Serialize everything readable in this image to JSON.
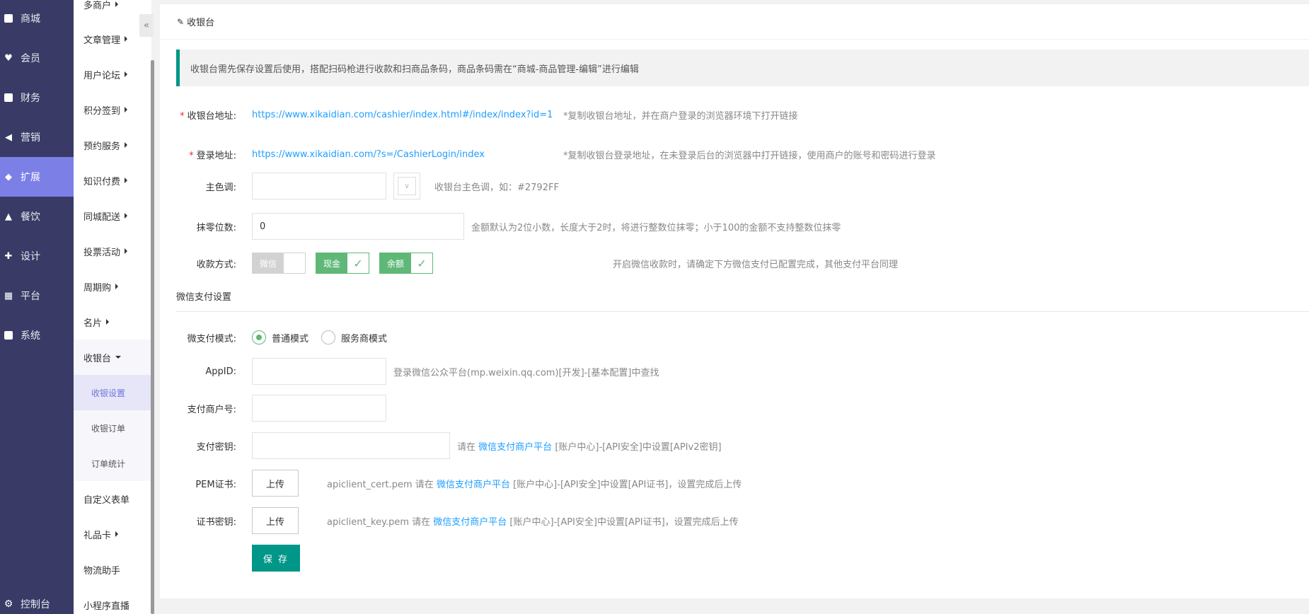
{
  "nav_primary": [
    {
      "label": "商城",
      "icon": "shop-icon"
    },
    {
      "label": "会员",
      "icon": "member-icon"
    },
    {
      "label": "财务",
      "icon": "finance-icon"
    },
    {
      "label": "营销",
      "icon": "megaphone-icon"
    },
    {
      "label": "扩展",
      "icon": "cube-icon"
    },
    {
      "label": "餐饮",
      "icon": "dining-icon"
    },
    {
      "label": "设计",
      "icon": "puzzle-icon"
    },
    {
      "label": "平台",
      "icon": "grid-icon"
    },
    {
      "label": "系统",
      "icon": "monitor-icon"
    }
  ],
  "nav_bottom": {
    "label": "控制台",
    "icon": "gear-icon"
  },
  "nav_secondary": [
    {
      "label": "多商户"
    },
    {
      "label": "文章管理"
    },
    {
      "label": "用户论坛"
    },
    {
      "label": "积分签到"
    },
    {
      "label": "预约服务"
    },
    {
      "label": "知识付费"
    },
    {
      "label": "同城配送"
    },
    {
      "label": "投票活动"
    },
    {
      "label": "周期购"
    },
    {
      "label": "名片"
    },
    {
      "label": "收银台"
    },
    {
      "label": "收银设置"
    },
    {
      "label": "收银订单"
    },
    {
      "label": "订单统计"
    },
    {
      "label": "自定义表单"
    },
    {
      "label": "礼品卡"
    },
    {
      "label": "物流助手"
    },
    {
      "label": "小程序直播"
    }
  ],
  "collapse_glyph": "«",
  "header": {
    "title": "收银台"
  },
  "notice": "收银台需先保存设置后使用，搭配扫码枪进行收款和扫商品条码，商品条码需在“商城-商品管理-编辑”进行编辑",
  "cashier_url": {
    "label": "收银台地址:",
    "value": "https://www.xikaidian.com/cashier/index.html#/index/index?id=1",
    "hint": "*复制收银台地址，并在商户登录的浏览器环境下打开链接"
  },
  "login_url": {
    "label": "登录地址:",
    "value": "https://www.xikaidian.com/?s=/CashierLogin/index",
    "hint": "*复制收银台登录地址，在未登录后台的浏览器中打开链接，使用商户的账号和密码进行登录"
  },
  "main_color": {
    "label": "主色调:",
    "value": "",
    "hint": "收银台主色调，如：#2792FF"
  },
  "rounding": {
    "label": "抹零位数:",
    "value": "0",
    "hint": "金额默认为2位小数，长度大于2时，将进行整数位抹零；小于100的金额不支持整数位抹零"
  },
  "pay_methods": {
    "label": "收款方式:",
    "options": [
      {
        "label": "微信",
        "checked": false
      },
      {
        "label": "现金",
        "checked": true
      },
      {
        "label": "余额",
        "checked": true
      }
    ],
    "hint": "开启微信收款时，请确定下方微信支付已配置完成，其他支付平台同理"
  },
  "wechat_section": {
    "title": "微信支付设置"
  },
  "pay_mode": {
    "label": "微支付模式:",
    "options": [
      {
        "label": "普通模式",
        "selected": true
      },
      {
        "label": "服务商模式",
        "selected": false
      }
    ]
  },
  "appid": {
    "label": "AppID:",
    "value": "",
    "hint": "登录微信公众平台(mp.weixin.qq.com)[开发]-[基本配置]中查找"
  },
  "merchant_no": {
    "label": "支付商户号:",
    "value": ""
  },
  "pay_key": {
    "label": "支付密钥:",
    "value": "",
    "hint_pre": "请在",
    "hint_link": "微信支付商户平台",
    "hint_post": "[账户中心]-[API安全]中设置[APIv2密钥]"
  },
  "pem_cert": {
    "label": "PEM证书:",
    "button": "上传",
    "hint_pre": "apiclient_cert.pem 请在",
    "hint_link": "微信支付商户平台",
    "hint_post": "[账户中心]-[API安全]中设置[API证书]，设置完成后上传"
  },
  "cert_key": {
    "label": "证书密钥:",
    "button": "上传",
    "hint_pre": "apiclient_key.pem 请在",
    "hint_link": "微信支付商户平台",
    "hint_post": "[账户中心]-[API安全]中设置[API证书]，设置完成后上传"
  },
  "save_button": "保 存",
  "colors": {
    "sidebar": "#393b66",
    "active": "#7b7fe6",
    "accent": "#009688",
    "switch_on": "#5fb878",
    "link": "#1e9fff"
  }
}
